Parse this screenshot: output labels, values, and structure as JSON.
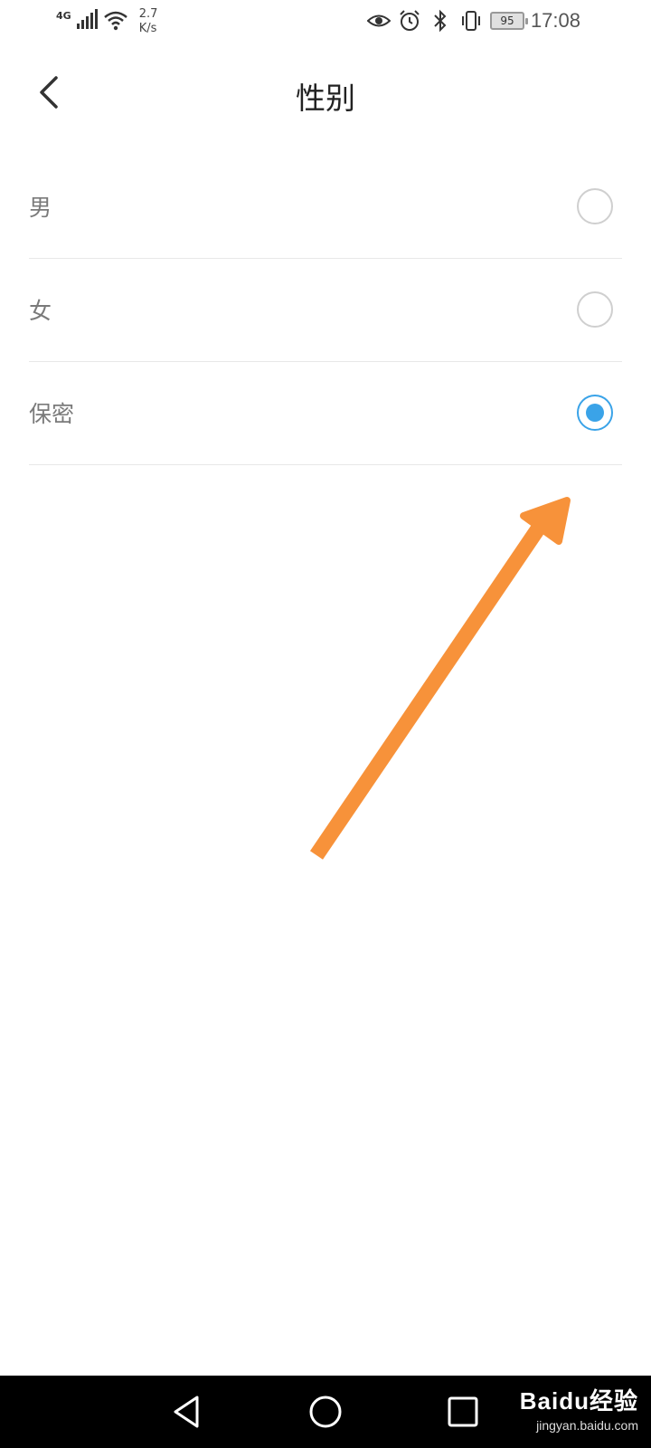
{
  "status_bar": {
    "network_type": "4G",
    "net_speed_value": "2.7",
    "net_speed_unit": "K/s",
    "battery_level": "95",
    "time": "17:08"
  },
  "header": {
    "title": "性别",
    "back_icon": "chevron-left-icon"
  },
  "options": [
    {
      "label": "男",
      "selected": false
    },
    {
      "label": "女",
      "selected": false
    },
    {
      "label": "保密",
      "selected": true
    }
  ],
  "colors": {
    "accent": "#3aa3e8",
    "annotation_arrow": "#f7923a",
    "divider": "#e8e8e8"
  },
  "nav_bar": {
    "back_icon": "triangle-back-icon",
    "home_icon": "circle-home-icon",
    "recents_icon": "square-recents-icon"
  },
  "watermark": {
    "brand": "Baidu经验",
    "url": "jingyan.baidu.com"
  }
}
